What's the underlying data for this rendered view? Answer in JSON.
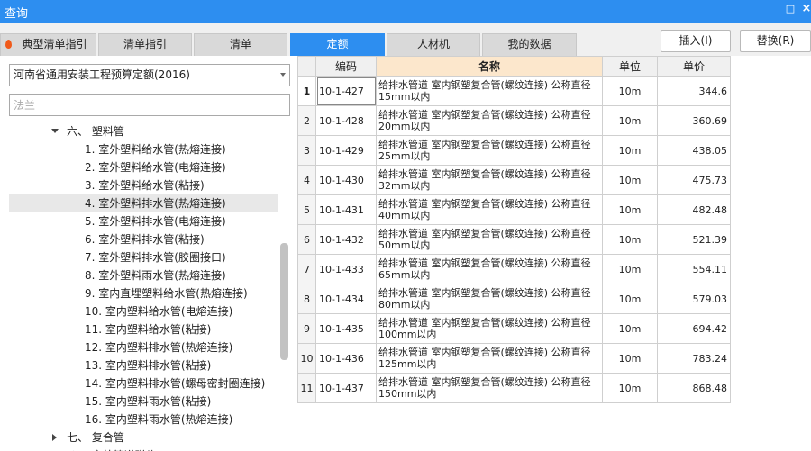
{
  "window": {
    "title": "查询",
    "minimize_label": "□",
    "close_label": "×"
  },
  "tabs": [
    {
      "label": "典型清单指引",
      "active": false
    },
    {
      "label": "清单指引",
      "active": false
    },
    {
      "label": "清单",
      "active": false
    },
    {
      "label": "定额",
      "active": true
    },
    {
      "label": "人材机",
      "active": false
    },
    {
      "label": "我的数据",
      "active": false
    }
  ],
  "actions": {
    "insert_label": "插入(I)",
    "replace_label": "替换(R)"
  },
  "library": {
    "selected": "河南省通用安装工程预算定额(2016)"
  },
  "search": {
    "value": "",
    "placeholder": "法兰"
  },
  "tree": {
    "items": [
      {
        "label": "六、 塑料管",
        "level": 0,
        "expanded": true,
        "selected": false
      },
      {
        "label": "1. 室外塑料给水管(热熔连接)",
        "level": 1,
        "selected": false
      },
      {
        "label": "2. 室外塑料给水管(电熔连接)",
        "level": 1,
        "selected": false
      },
      {
        "label": "3. 室外塑料给水管(粘接)",
        "level": 1,
        "selected": false
      },
      {
        "label": "4. 室外塑料排水管(热熔连接)",
        "level": 1,
        "selected": true
      },
      {
        "label": "5. 室外塑料排水管(电熔连接)",
        "level": 1,
        "selected": false
      },
      {
        "label": "6. 室外塑料排水管(粘接)",
        "level": 1,
        "selected": false
      },
      {
        "label": "7. 室外塑料排水管(胶圈接口)",
        "level": 1,
        "selected": false
      },
      {
        "label": "8. 室外塑料雨水管(热熔连接)",
        "level": 1,
        "selected": false
      },
      {
        "label": "9. 室内直埋塑料给水管(热熔连接)",
        "level": 1,
        "selected": false
      },
      {
        "label": "10. 室内塑料给水管(电熔连接)",
        "level": 1,
        "selected": false
      },
      {
        "label": "11. 室内塑料给水管(粘接)",
        "level": 1,
        "selected": false
      },
      {
        "label": "12. 室内塑料排水管(热熔连接)",
        "level": 1,
        "selected": false
      },
      {
        "label": "13. 室内塑料排水管(粘接)",
        "level": 1,
        "selected": false
      },
      {
        "label": "14. 室内塑料排水管(螺母密封圈连接)",
        "level": 1,
        "selected": false
      },
      {
        "label": "15. 室内塑料雨水管(粘接)",
        "level": 1,
        "selected": false
      },
      {
        "label": "16. 室内塑料雨水管(热熔连接)",
        "level": 1,
        "selected": false
      },
      {
        "label": "七、 复合管",
        "level": 0,
        "expanded": false,
        "selected": false
      },
      {
        "label": "八、 室外管道碰头",
        "level": 0,
        "expanded": false,
        "selected": false
      }
    ]
  },
  "grid": {
    "columns": {
      "code": "编码",
      "name": "名称",
      "unit": "单位",
      "price": "单价"
    },
    "rows": [
      {
        "index": "1",
        "code": "10-1-427",
        "name": "给排水管道 室内钢塑复合管(螺纹连接) 公称直径15mm以内",
        "unit": "10m",
        "price": "344.6"
      },
      {
        "index": "2",
        "code": "10-1-428",
        "name": "给排水管道 室内钢塑复合管(螺纹连接) 公称直径20mm以内",
        "unit": "10m",
        "price": "360.69"
      },
      {
        "index": "3",
        "code": "10-1-429",
        "name": "给排水管道 室内钢塑复合管(螺纹连接) 公称直径25mm以内",
        "unit": "10m",
        "price": "438.05"
      },
      {
        "index": "4",
        "code": "10-1-430",
        "name": "给排水管道 室内钢塑复合管(螺纹连接) 公称直径32mm以内",
        "unit": "10m",
        "price": "475.73"
      },
      {
        "index": "5",
        "code": "10-1-431",
        "name": "给排水管道 室内钢塑复合管(螺纹连接) 公称直径40mm以内",
        "unit": "10m",
        "price": "482.48"
      },
      {
        "index": "6",
        "code": "10-1-432",
        "name": "给排水管道 室内钢塑复合管(螺纹连接) 公称直径50mm以内",
        "unit": "10m",
        "price": "521.39"
      },
      {
        "index": "7",
        "code": "10-1-433",
        "name": "给排水管道 室内钢塑复合管(螺纹连接) 公称直径65mm以内",
        "unit": "10m",
        "price": "554.11"
      },
      {
        "index": "8",
        "code": "10-1-434",
        "name": "给排水管道 室内钢塑复合管(螺纹连接) 公称直径80mm以内",
        "unit": "10m",
        "price": "579.03"
      },
      {
        "index": "9",
        "code": "10-1-435",
        "name": "给排水管道 室内钢塑复合管(螺纹连接) 公称直径100mm以内",
        "unit": "10m",
        "price": "694.42"
      },
      {
        "index": "10",
        "code": "10-1-436",
        "name": "给排水管道 室内钢塑复合管(螺纹连接) 公称直径125mm以内",
        "unit": "10m",
        "price": "783.24"
      },
      {
        "index": "11",
        "code": "10-1-437",
        "name": "给排水管道 室内钢塑复合管(螺纹连接) 公称直径150mm以内",
        "unit": "10m",
        "price": "868.48"
      }
    ],
    "selected_row": 0
  },
  "colors": {
    "accent": "#2d8ef0",
    "header_highlight": "#fce7cc",
    "tab_inactive": "#d9d9d9"
  },
  "icons": {
    "tab0": "fire-icon",
    "minimize": "maximize-icon",
    "close": "close-icon"
  }
}
